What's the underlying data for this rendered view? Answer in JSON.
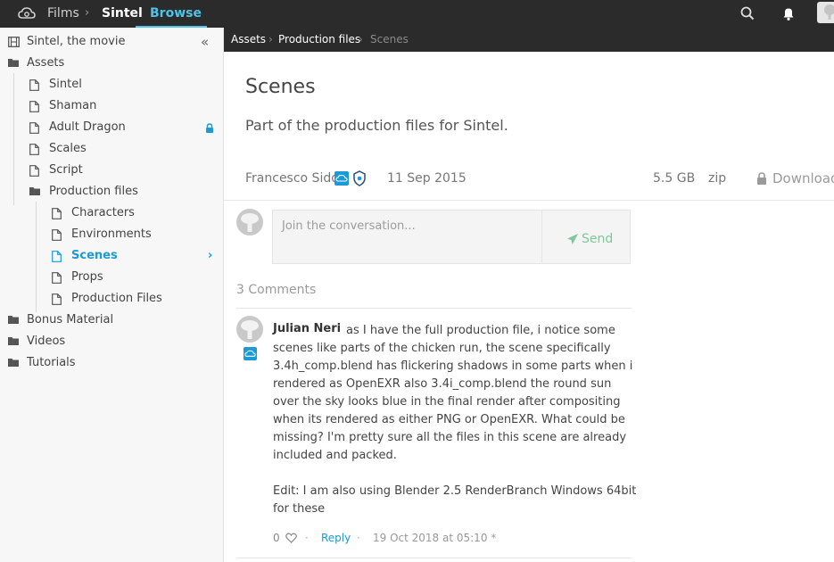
{
  "topbar": {
    "films": "Films",
    "sintel": "Sintel",
    "browse": "Browse"
  },
  "sidebar": {
    "root": "Sintel, the movie",
    "assets": "Assets",
    "assets_children": [
      "Sintel",
      "Shaman",
      "Adult Dragon",
      "Scales",
      "Script"
    ],
    "production_files": "Production files",
    "production_children": [
      "Characters",
      "Environments",
      "Scenes",
      "Props",
      "Production Files"
    ],
    "after": [
      "Bonus Material",
      "Videos",
      "Tutorials"
    ]
  },
  "breadcrumb": {
    "assets": "Assets",
    "production_files": "Production files",
    "current": "Scenes"
  },
  "node": {
    "title": "Scenes",
    "description": "Part of the production files for Sintel.",
    "author": "Francesco Siddi",
    "date": "11 Sep 2015",
    "size": "5.5 GB",
    "format": "zip",
    "download": "Download"
  },
  "compose": {
    "placeholder": "Join the conversation...",
    "send": "Send"
  },
  "comments": {
    "count": "3 Comments",
    "items": [
      {
        "author": "Julian Neri",
        "text": "as I have the full production file, i notice some scenes like parts of the chicken run, the scene specifically 3.4h_comp.blend has flickering shadows in some parts when i rendered as OpenEXR also 3.4i_comp.blend the round sun over the sky looks blue in the final render after compositing when its rendered as either PNG or OpenEXR. What could be missing? I'm pretty sure all the files in this scene are already included and packed.",
        "edit": "Edit: I am also using Blender 2.5 RenderBranch Windows 64bit for these",
        "likes": "0",
        "reply": "Reply",
        "timestamp": "19 Oct 2018 at 05:10 *"
      }
    ]
  },
  "colors": {
    "accent": "#1a9ad6",
    "topbar": "#2b2b2b",
    "send": "#7ec89a"
  }
}
